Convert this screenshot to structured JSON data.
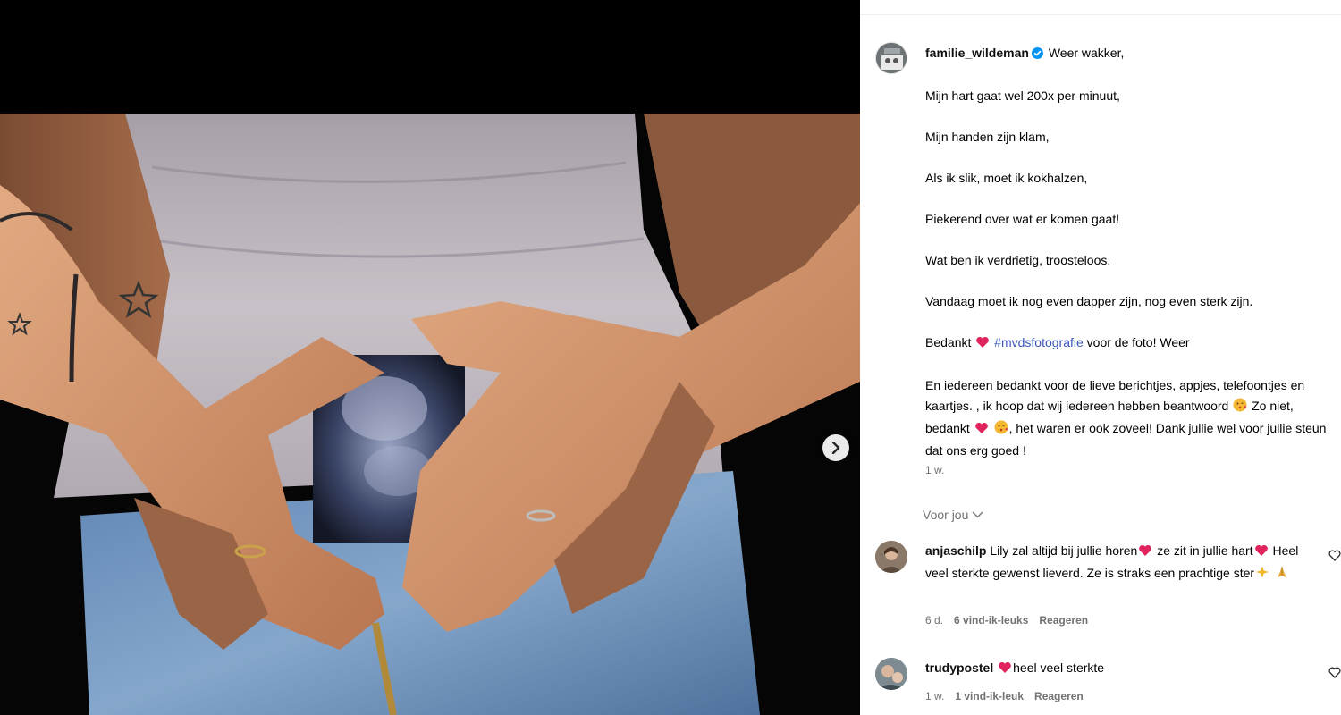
{
  "post": {
    "username": "familie_wildeman",
    "caption_first": "Weer wakker,",
    "caption_lines": [
      "Mijn hart gaat wel 200x per minuut,",
      "Mijn handen zijn klam,",
      "Als ik slik, moet ik kokhalzen,",
      "Piekerend over wat er komen gaat!",
      "Wat ben ik verdrietig, troosteloos.",
      "Vandaag moet ik nog even dapper zijn, nog even sterk zijn."
    ],
    "thanks_prefix": "Bedankt",
    "hashtag": "#mvdsfotografie",
    "thanks_suffix": "voor de foto! Weer",
    "para_a": "En iedereen bedankt voor de lieve berichtjes, appjes, telefoontjes en kaartjes. , ik hoop dat wij iedereen hebben beantwoord",
    "para_b": "Zo niet, bedankt",
    "para_c": ", het waren er ook zoveel! Dank jullie wel voor jullie steun dat ons erg goed !",
    "time": "1 w."
  },
  "voor_jou_label": "Voor jou",
  "comments": [
    {
      "username": "anjaschilp",
      "text_a": "Lily zal altijd bij jullie horen",
      "text_b": "ze zit in jullie hart",
      "text_c": "Heel veel sterkte gewenst lieverd. Ze is straks een prachtige ster",
      "time": "6 d.",
      "likes": "6 vind-ik-leuks",
      "reply": "Reageren"
    },
    {
      "username": "trudypostel",
      "text": "heel veel sterkte",
      "time": "1 w.",
      "likes": "1 vind-ik-leuk",
      "reply": "Reageren"
    }
  ],
  "icons": {
    "verified": "verified-badge-icon",
    "next": "chevron-right-icon",
    "heart": "heart-outline-icon",
    "chevron_down": "chevron-down-icon"
  },
  "colors": {
    "verified": "#0095f6",
    "hashtag": "#3a57b8",
    "heart_emoji": "#e0245e",
    "meta_text": "#737373"
  }
}
